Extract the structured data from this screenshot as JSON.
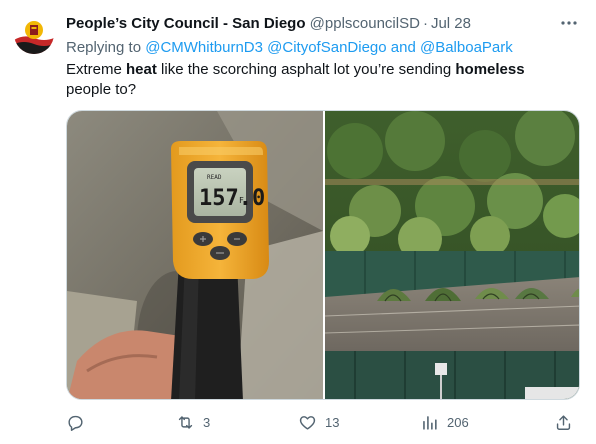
{
  "tweet": {
    "author_name": "People’s City Council - San Diego",
    "author_handle": "@pplscouncilSD",
    "date": "Jul 28",
    "more_icon": "more-horizontal-icon",
    "reply_prefix": "Replying to",
    "reply_mention_1": "@CMWhitburnD3",
    "reply_mention_2": "@CityofSanDiego",
    "reply_and": "and",
    "reply_mention_3": "@BalboaPark",
    "text_1": "Extreme ",
    "text_bold_1": "heat",
    "text_2": " like the scorching asphalt lot you’re sending ",
    "text_bold_2": "homeless",
    "text_3": " people to?",
    "thermometer_reading": "157.0",
    "thermometer_unit": "F"
  },
  "actions": {
    "reply_icon": "reply-icon",
    "retweet_icon": "retweet-icon",
    "retweets": "3",
    "like_icon": "heart-icon",
    "likes": "13",
    "views_icon": "views-icon",
    "views": "206",
    "share_icon": "share-icon"
  },
  "colors": {
    "link": "#1d9bf0",
    "secondary": "#536471",
    "primary": "#0f1419"
  }
}
